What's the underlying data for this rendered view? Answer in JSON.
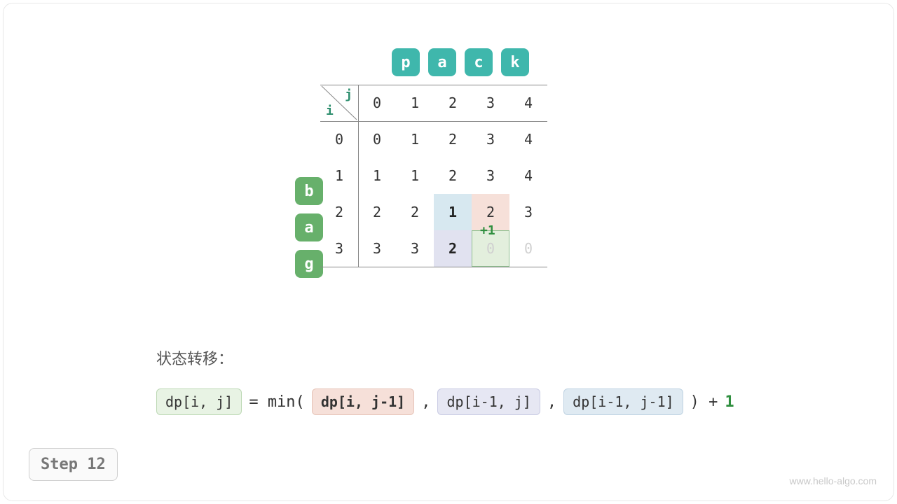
{
  "top_word": [
    "p",
    "a",
    "c",
    "k"
  ],
  "left_word": [
    "b",
    "a",
    "g"
  ],
  "axis": {
    "i": "i",
    "j": "j"
  },
  "col_headers": [
    "0",
    "1",
    "2",
    "3",
    "4"
  ],
  "row_headers": [
    "0",
    "1",
    "2",
    "3"
  ],
  "grid": [
    [
      "0",
      "1",
      "2",
      "3",
      "4"
    ],
    [
      "1",
      "1",
      "2",
      "3",
      "4"
    ],
    [
      "2",
      "2",
      "1",
      "2",
      "3"
    ],
    [
      "3",
      "3",
      "2",
      "0",
      "0"
    ]
  ],
  "bold_cells": [
    [
      2,
      2
    ],
    [
      3,
      2
    ]
  ],
  "faded_cells": [
    [
      3,
      3
    ],
    [
      3,
      4
    ]
  ],
  "highlights": {
    "blue": {
      "r": 2,
      "c": 1
    },
    "pink": {
      "r": 2,
      "c": 2
    },
    "lav": {
      "r": 3,
      "c": 1
    },
    "green": {
      "r": 3,
      "c": 2
    }
  },
  "plus_one": "+1",
  "formula": {
    "title": "状态转移：",
    "lhs": "dp[i, j]",
    "eq": " = min( ",
    "a": "dp[i, j-1]",
    "b": "dp[i-1, j]",
    "c": "dp[i-1, j-1]",
    "tail": " ) + ",
    "one": "1"
  },
  "step_label": "Step 12",
  "watermark": "www.hello-algo.com",
  "chart_data": {
    "type": "table",
    "description": "Edit-distance DP table between source 'bag' (rows, i) and target 'pack' (cols, j). Cell dp[i][j] is minimum edits.",
    "row_labels": [
      "",
      "b",
      "a",
      "g"
    ],
    "col_labels": [
      "",
      "p",
      "a",
      "c",
      "k"
    ],
    "values": [
      [
        0,
        1,
        2,
        3,
        4
      ],
      [
        1,
        1,
        2,
        3,
        4
      ],
      [
        2,
        2,
        1,
        2,
        3
      ],
      [
        3,
        3,
        2,
        null,
        null
      ]
    ],
    "current_cell": {
      "i": 3,
      "j": 2,
      "value": 2
    },
    "transition": "dp[i,j] = min(dp[i,j-1], dp[i-1,j], dp[i-1,j-1]) + 1"
  }
}
